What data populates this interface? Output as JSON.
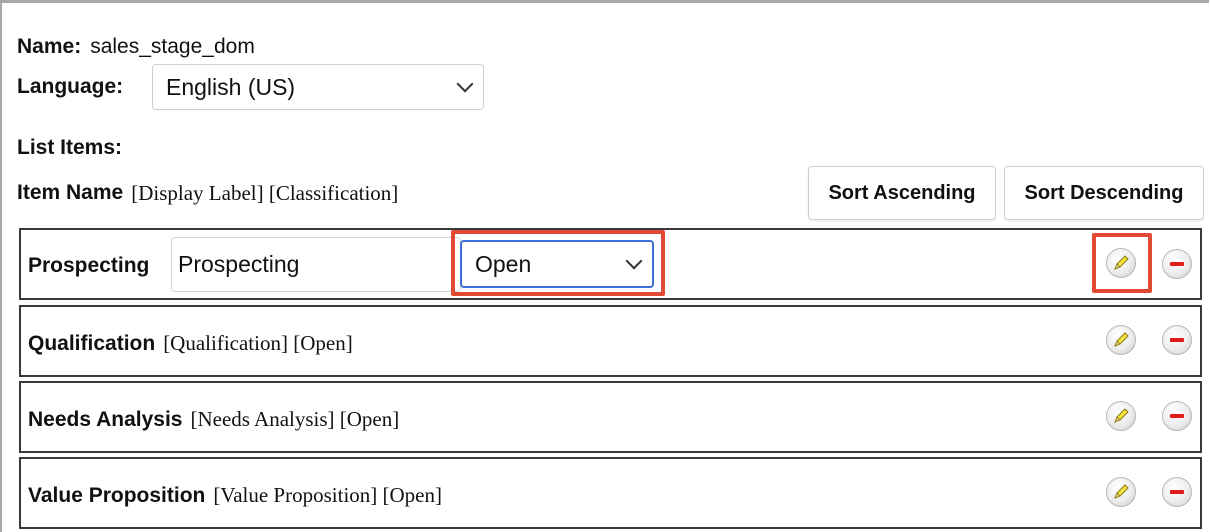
{
  "header": {
    "name_label": "Name:",
    "name_value": "sales_stage_dom",
    "language_label": "Language:",
    "language_value": "English (US)"
  },
  "list": {
    "title": "List Items:",
    "column_header_bold": "Item Name",
    "column_header_rest": "[Display Label] [Classification]",
    "sort_ascending_label": "Sort Ascending",
    "sort_descending_label": "Sort Descending"
  },
  "editing_item": {
    "name": "Prospecting",
    "display_label_value": "Prospecting",
    "classification_value": "Open"
  },
  "items": [
    {
      "name": "Qualification",
      "rest": "[Qualification] [Open]"
    },
    {
      "name": "Needs Analysis",
      "rest": "[Needs Analysis] [Open]"
    },
    {
      "name": "Value Proposition",
      "rest": "[Value Proposition] [Open]"
    }
  ],
  "colors": {
    "highlight": "#e34a35",
    "delete_red": "#e01b1b",
    "pencil_yellow": "#f3e33a"
  },
  "icons": {
    "edit": "pencil-icon",
    "delete": "minus-circle-icon",
    "dropdown": "chevron-down-icon"
  }
}
